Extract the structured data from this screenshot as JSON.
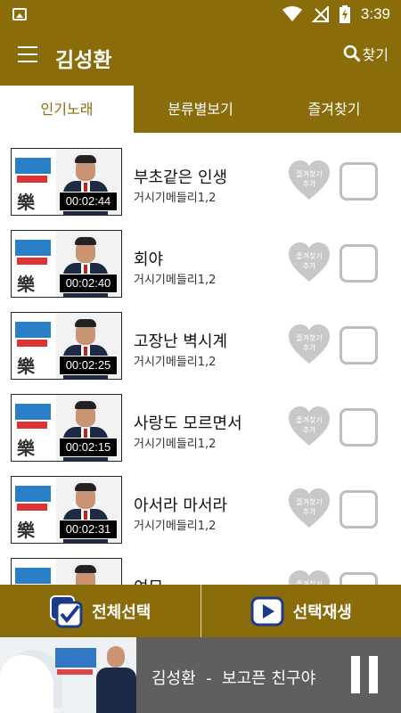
{
  "status_bar": {
    "time": "3:39",
    "icons": [
      "image-notification-icon",
      "wifi-icon",
      "no-signal-icon",
      "battery-charging-icon"
    ]
  },
  "app_bar": {
    "title": "김성환",
    "search_label": "찾기",
    "icons": [
      "menu-icon",
      "search-icon"
    ]
  },
  "tabs": [
    {
      "label": "인기노래",
      "active": true
    },
    {
      "label": "분류별보기",
      "active": false
    },
    {
      "label": "즐겨찾기",
      "active": false
    }
  ],
  "songs": [
    {
      "title": "부초같은 인생",
      "album": "거시기메들리1,2",
      "duration": "00:02:44",
      "fav_label": "즐겨찾기\n추가"
    },
    {
      "title": "회야",
      "album": "거시기메들리1,2",
      "duration": "00:02:40",
      "fav_label": "즐겨찾기\n추가"
    },
    {
      "title": "고장난 벽시계",
      "album": "거시기메들리1,2",
      "duration": "00:02:25",
      "fav_label": "즐겨찾기\n추가"
    },
    {
      "title": "사랑도 모르면서",
      "album": "거시기메들리1,2",
      "duration": "00:02:15",
      "fav_label": "즐겨찾기\n추가"
    },
    {
      "title": "아서라 마서라",
      "album": "거시기메들리1,2",
      "duration": "00:02:31",
      "fav_label": "즐겨찾기\n추가"
    },
    {
      "title": "여모",
      "album": "",
      "duration": "",
      "fav_label": "즐겨찾기\n추가"
    }
  ],
  "bottom_bar": {
    "select_all_label": "전체선택",
    "play_selected_label": "선택재생"
  },
  "player": {
    "now_playing": "김성환  -  보고픈 친구야"
  },
  "colors": {
    "primary": "#8b6c0b",
    "player_bg": "#5f5f5f",
    "checkbox_border": "#bdbdbd",
    "favorite_heart": "#c8c8c8"
  }
}
